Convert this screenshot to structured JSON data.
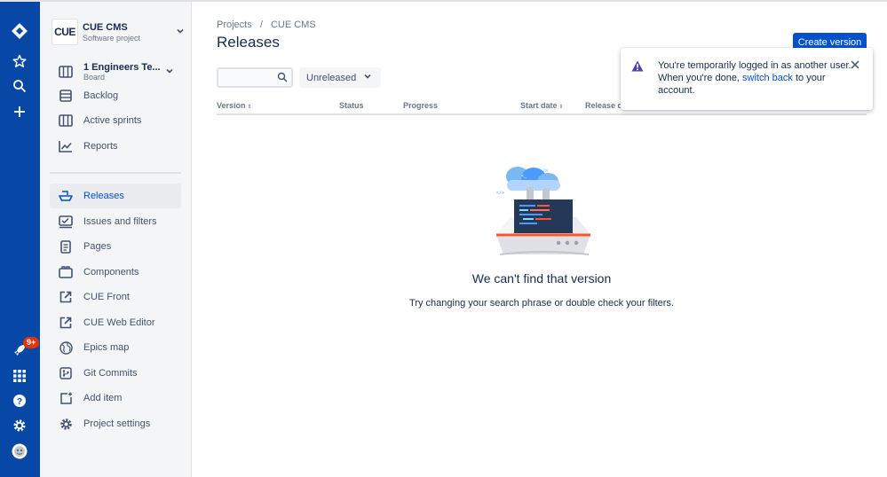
{
  "global_nav": {
    "notification_badge": "9+",
    "icons": [
      "jira-logo-icon",
      "star-icon",
      "search-icon",
      "plus-icon",
      "rocket-icon",
      "app-switcher-icon",
      "help-icon",
      "settings-icon",
      "avatar-icon"
    ]
  },
  "project": {
    "logo_text": "CUE",
    "name": "CUE CMS",
    "type": "Software project"
  },
  "sidebar": {
    "board": {
      "name": "1 Engineers Te...",
      "sub": "Board"
    },
    "items": [
      {
        "label": "Backlog",
        "icon": "backlog-icon"
      },
      {
        "label": "Active sprints",
        "icon": "board-icon"
      },
      {
        "label": "Reports",
        "icon": "reports-icon"
      },
      {
        "label": "Releases",
        "icon": "ship-icon",
        "active": true
      },
      {
        "label": "Issues and filters",
        "icon": "issues-icon"
      },
      {
        "label": "Pages",
        "icon": "page-icon"
      },
      {
        "label": "Components",
        "icon": "component-icon"
      },
      {
        "label": "CUE Front",
        "icon": "external-link-icon"
      },
      {
        "label": "CUE Web Editor",
        "icon": "external-link-icon"
      },
      {
        "label": "Epics map",
        "icon": "globe-icon"
      },
      {
        "label": "Git Commits",
        "icon": "git-icon"
      },
      {
        "label": "Add item",
        "icon": "add-item-icon"
      },
      {
        "label": "Project settings",
        "icon": "settings-icon"
      }
    ]
  },
  "breadcrumb": {
    "projects": "Projects",
    "separator": "/",
    "project": "CUE CMS"
  },
  "page_title": "Releases",
  "create_button": "Create version",
  "search": {
    "value": "",
    "placeholder": ""
  },
  "filter": {
    "selected": "Unreleased"
  },
  "table": {
    "columns": [
      "Version",
      "Status",
      "Progress",
      "Start date",
      "Release d"
    ]
  },
  "empty_state": {
    "title": "We can't find that version",
    "subtitle": "Try changing your search phrase or double check your filters."
  },
  "flag": {
    "text_before": "You're temporarily logged in as another user. When you're done, ",
    "link": "switch back",
    "text_after": " to your account."
  },
  "colors": {
    "nav": "#0747a6",
    "accent": "#0052cc",
    "warning": "#5243aa",
    "badge": "#de350b"
  }
}
